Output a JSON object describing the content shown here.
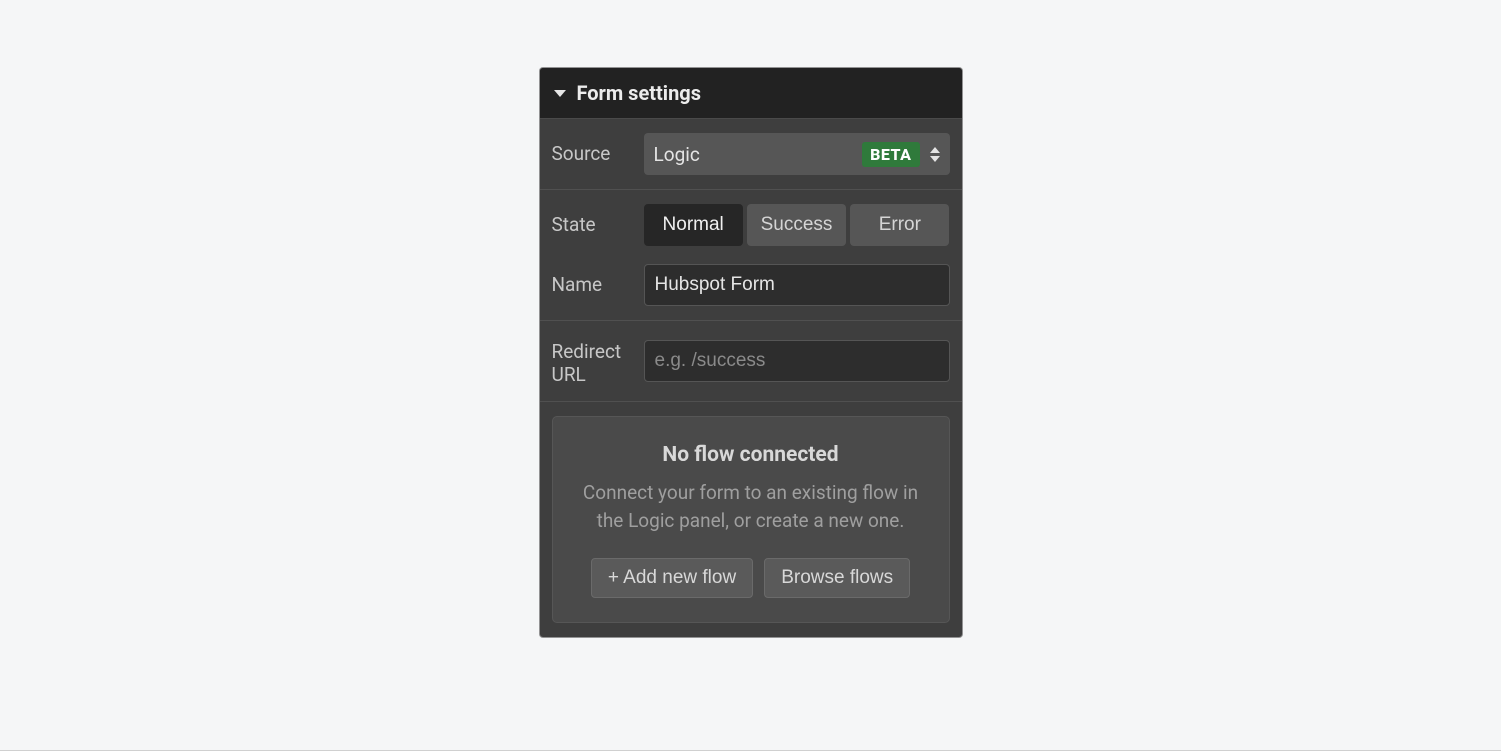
{
  "header": {
    "title": "Form settings"
  },
  "source": {
    "label": "Source",
    "value": "Logic",
    "badge": "BETA"
  },
  "state": {
    "label": "State",
    "options": [
      "Normal",
      "Success",
      "Error"
    ],
    "active": "Normal"
  },
  "name": {
    "label": "Name",
    "value": "Hubspot Form"
  },
  "redirect": {
    "label": "Redirect URL",
    "placeholder": "e.g. /success",
    "value": ""
  },
  "flow": {
    "title": "No flow connected",
    "description": "Connect your form to an existing flow in the Logic panel, or create a new one.",
    "add_label": "+ Add new flow",
    "browse_label": "Browse flows"
  }
}
